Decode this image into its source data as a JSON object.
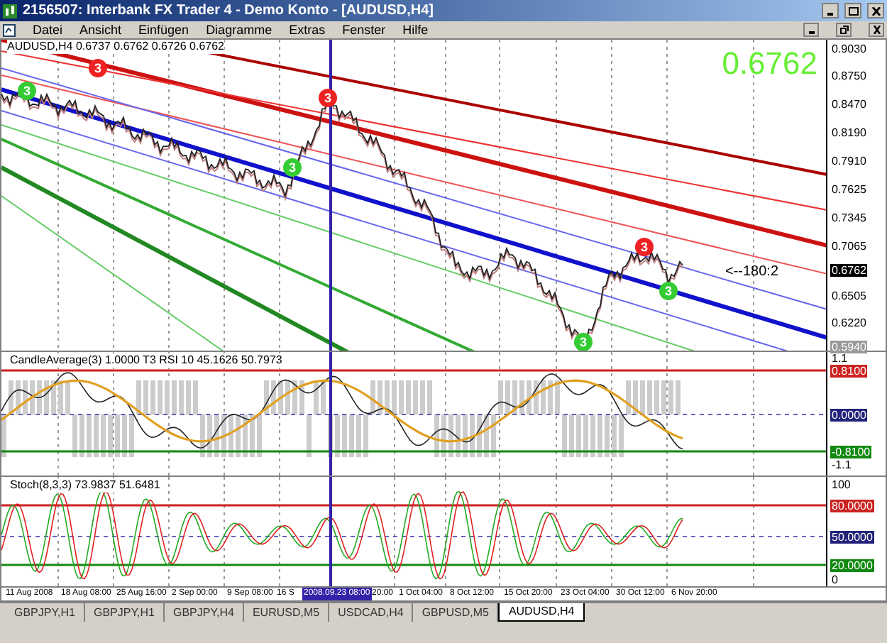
{
  "window": {
    "title": "2156507: Interbank FX Trader 4 - Demo Konto - [AUDUSD,H4]"
  },
  "menu": [
    "Datei",
    "Ansicht",
    "Einfügen",
    "Diagramme",
    "Extras",
    "Fenster",
    "Hilfe"
  ],
  "main_chart": {
    "info": "AUDUSD,H4  0.6737 0.6762 0.6726 0.6762",
    "big_price": "0.6762",
    "note": "<--180:2",
    "price_axis": [
      {
        "label": "0.9030",
        "kind": "tick"
      },
      {
        "label": "0.8750",
        "kind": "tick"
      },
      {
        "label": "0.8470",
        "kind": "tick"
      },
      {
        "label": "0.8190",
        "kind": "tick"
      },
      {
        "label": "0.7910",
        "kind": "tick"
      },
      {
        "label": "0.7625",
        "kind": "tick"
      },
      {
        "label": "0.7345",
        "kind": "tick"
      },
      {
        "label": "0.7065",
        "kind": "tick"
      },
      {
        "label": "0.6762",
        "kind": "current"
      },
      {
        "label": "0.6505",
        "kind": "tick"
      },
      {
        "label": "0.6220",
        "kind": "tick"
      },
      {
        "label": "0.5940",
        "kind": "grey"
      }
    ],
    "signals": [
      {
        "label": "3",
        "color": "#33cc33"
      },
      {
        "label": "3",
        "color": "#ee2222"
      },
      {
        "label": "3",
        "color": "#ee2222"
      },
      {
        "label": "3",
        "color": "#33cc33"
      },
      {
        "label": "3",
        "color": "#ee2222"
      },
      {
        "label": "3",
        "color": "#33cc33"
      },
      {
        "label": "3",
        "color": "#33cc33"
      }
    ]
  },
  "rsi_panel": {
    "info": "CandleAverage(3) 1.0000  T3 RSI 10 45.1626 50.7973",
    "axis": [
      {
        "label": "1.1",
        "kind": "plain"
      },
      {
        "label": "0.8100",
        "kind": "red"
      },
      {
        "label": "0.0000",
        "kind": "blue"
      },
      {
        "label": "-0.8100",
        "kind": "green"
      },
      {
        "label": "-1.1",
        "kind": "plain"
      }
    ]
  },
  "stoch_panel": {
    "info": "Stoch(8,3,3) 73.9837 51.6481",
    "axis": [
      {
        "label": "100",
        "kind": "plain"
      },
      {
        "label": "80.0000",
        "kind": "red"
      },
      {
        "label": "50.0000",
        "kind": "blue"
      },
      {
        "label": "20.0000",
        "kind": "green"
      },
      {
        "label": "0",
        "kind": "plain"
      }
    ]
  },
  "time_axis": [
    {
      "label": "11 Aug 2008",
      "kind": "tick"
    },
    {
      "label": "18 Aug 08:00",
      "kind": "tick"
    },
    {
      "label": "25 Aug 16:00",
      "kind": "tick"
    },
    {
      "label": "2 Sep 00:00",
      "kind": "tick"
    },
    {
      "label": "9 Sep 08:00",
      "kind": "tick"
    },
    {
      "label": "16 S",
      "kind": "tick"
    },
    {
      "label": "2008.09.23 08:00",
      "kind": "cursor"
    },
    {
      "label": "20:00",
      "kind": "tick"
    },
    {
      "label": "1 Oct 04:00",
      "kind": "tick"
    },
    {
      "label": "8 Oct 12:00",
      "kind": "tick"
    },
    {
      "label": "15 Oct 20:00",
      "kind": "tick"
    },
    {
      "label": "23 Oct 04:00",
      "kind": "tick"
    },
    {
      "label": "30 Oct 12:00",
      "kind": "tick"
    },
    {
      "label": "6 Nov 20:00",
      "kind": "tick"
    }
  ],
  "tabs": [
    {
      "label": "GBPJPY,H1",
      "selected": false
    },
    {
      "label": "GBPJPY,H1",
      "selected": false
    },
    {
      "label": "GBPJPY,H4",
      "selected": false
    },
    {
      "label": "EURUSD,M5",
      "selected": false
    },
    {
      "label": "USDCAD,H4",
      "selected": false
    },
    {
      "label": "GBPUSD,M5",
      "selected": false
    },
    {
      "label": "AUDUSD,H4",
      "selected": true
    }
  ]
}
